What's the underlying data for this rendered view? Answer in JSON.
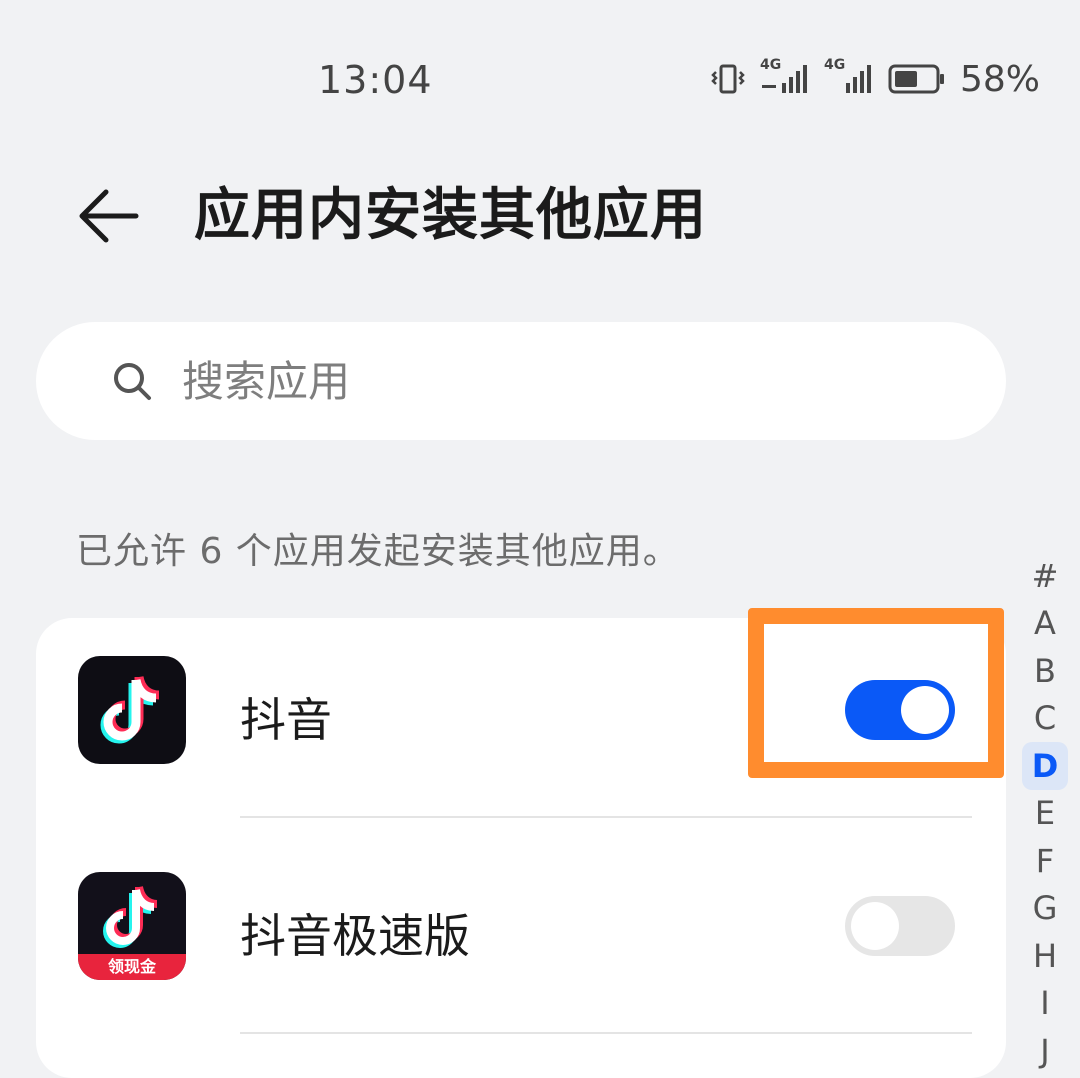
{
  "status_bar": {
    "time": "13:04",
    "signal_1": "4G",
    "signal_2": "4G",
    "battery_percent": "58%",
    "battery_level": 0.58
  },
  "header": {
    "back_icon": "arrow-left-icon",
    "title": "应用内安装其他应用"
  },
  "search": {
    "icon": "search-icon",
    "placeholder": "搜索应用",
    "value": ""
  },
  "summary_text": "已允许 6 个应用发起安装其他应用。",
  "apps": [
    {
      "name": "抖音",
      "icon": "douyin-icon",
      "enabled": true
    },
    {
      "name": "抖音极速版",
      "icon": "douyin-lite-icon",
      "badge": "领现金",
      "enabled": false
    }
  ],
  "alpha_index": {
    "letters": [
      "#",
      "A",
      "B",
      "C",
      "D",
      "E",
      "F",
      "G",
      "H",
      "I",
      "J"
    ],
    "active": "D"
  },
  "colors": {
    "accent": "#0a59f7",
    "highlight": "#ff8c2e",
    "background": "#f1f2f4",
    "toggle_off": "#e6e6e6"
  }
}
